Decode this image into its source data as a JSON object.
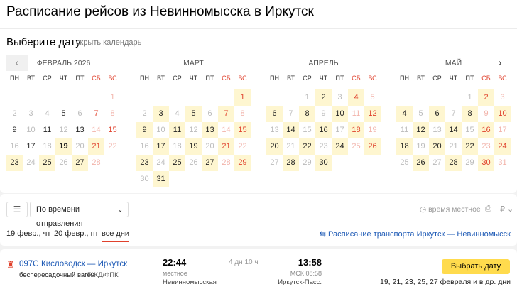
{
  "header": {
    "title": "Расписание рейсов из Невинномысска в Иркутск"
  },
  "calendar": {
    "heading": "Выберите дату",
    "hide_link": "скрыть календарь",
    "prev_icon": "‹",
    "next_icon": "›",
    "weekdays": [
      "ПН",
      "ВТ",
      "СР",
      "ЧТ",
      "ПТ",
      "СБ",
      "ВС"
    ],
    "today": {
      "month": 0,
      "day": 19
    },
    "months": [
      {
        "name": "ФЕВРАЛЬ 2026",
        "offset": 6,
        "days": 28,
        "available": [
          19,
          21,
          23,
          25,
          27
        ],
        "active": [
          5,
          7,
          9,
          11,
          13,
          15,
          17
        ]
      },
      {
        "name": "МАРТ",
        "offset": 6,
        "days": 31,
        "available": [
          1,
          3,
          5,
          7,
          9,
          11,
          13,
          15,
          17,
          19,
          21,
          23,
          25,
          27,
          29,
          31
        ],
        "active": []
      },
      {
        "name": "АПРЕЛЬ",
        "offset": 2,
        "days": 30,
        "available": [
          2,
          4,
          6,
          8,
          10,
          12,
          14,
          16,
          18,
          20,
          22,
          24,
          26,
          28,
          30
        ],
        "active": []
      },
      {
        "name": "МАЙ",
        "offset": 4,
        "days": 31,
        "available": [
          2,
          4,
          6,
          8,
          10,
          12,
          14,
          16,
          18,
          20,
          22,
          24,
          26,
          28,
          30
        ],
        "active": []
      }
    ]
  },
  "toolbar": {
    "sort_label": "По времени отправления",
    "timezone": "время местное",
    "currency": "₽"
  },
  "tabs": [
    "19 февр., чт",
    "20 февр., пт",
    "все дни"
  ],
  "reverse_link": "Расписание транспорта Иркутск — Невинномысск",
  "train": {
    "number": "097С",
    "route": "Кисловодск — Иркутск",
    "note": "беспересадочный вагон",
    "carrier": "РЖД/ФПК",
    "departure_time": "22:44",
    "departure_tz": "местное",
    "departure_station": "Невинномысская",
    "duration": "4 дн 10 ч",
    "arrival_time": "13:58",
    "arrival_msk": "МСК 08:58",
    "arrival_station": "Иркутск-Пасс.",
    "button": "Выбрать дату",
    "dates": "19, 21, 23, 25, 27 февраля и в др. дни"
  },
  "colors": {
    "accent": "#e0412c",
    "available": "#fef6d0",
    "link": "#1f5bb6",
    "button": "#ffdb4d"
  }
}
